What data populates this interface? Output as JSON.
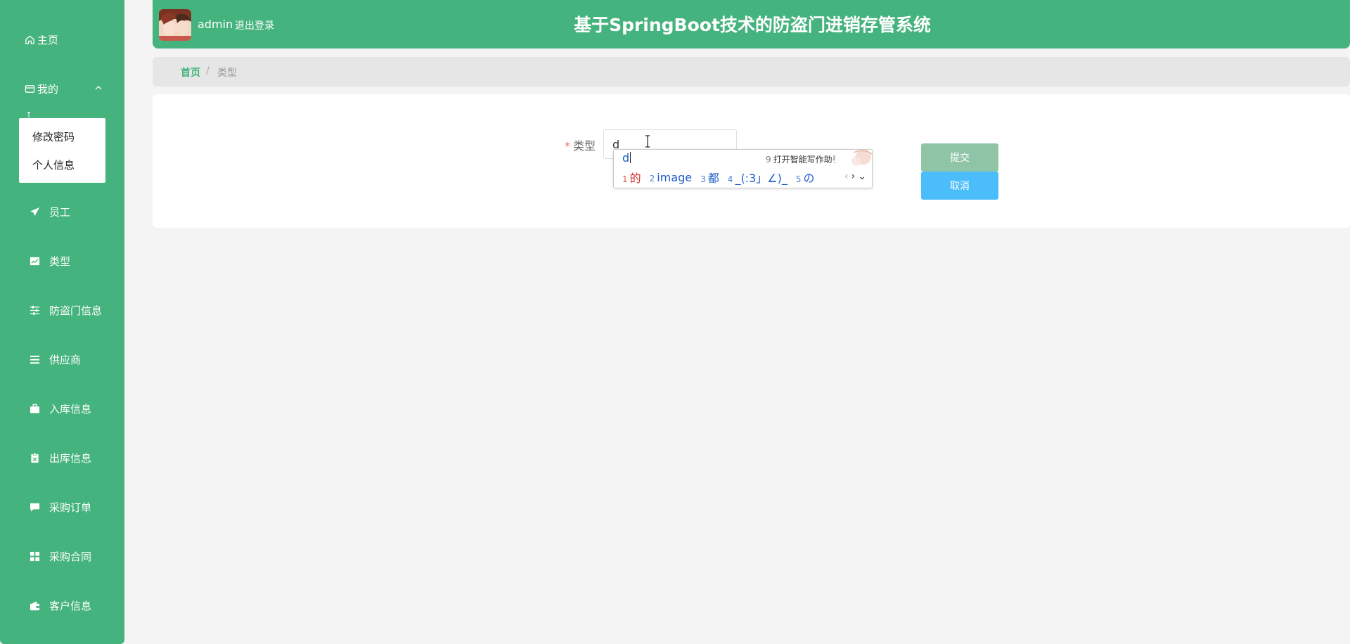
{
  "sidebar": {
    "home_label": "主页",
    "mine_label": "我的",
    "submenu": [
      {
        "label": "修改密码"
      },
      {
        "label": "个人信息"
      }
    ],
    "items": [
      {
        "label": "员工",
        "icon": "paper-plane-icon"
      },
      {
        "label": "类型",
        "icon": "chart-icon"
      },
      {
        "label": "防盗门信息",
        "icon": "sliders-icon"
      },
      {
        "label": "供应商",
        "icon": "list-icon"
      },
      {
        "label": "入库信息",
        "icon": "briefcase-icon"
      },
      {
        "label": "出库信息",
        "icon": "clipboard-icon"
      },
      {
        "label": "采购订单",
        "icon": "chat-icon"
      },
      {
        "label": "采购合同",
        "icon": "grid-icon"
      },
      {
        "label": "客户信息",
        "icon": "wallet-icon"
      }
    ]
  },
  "header": {
    "username": "admin",
    "logout_label": "退出登录",
    "title": "基于SpringBoot技术的防盗门进销存管系统"
  },
  "breadcrumb": {
    "home": "首页",
    "separator": "/",
    "current": "类型"
  },
  "form": {
    "required_mark": "*",
    "type_label": "类型",
    "type_value": "d",
    "submit_label": "提交",
    "cancel_label": "取消"
  },
  "ime": {
    "composition": "d",
    "assist_num": "9",
    "assist_label": "打开智能写作助手",
    "candidates": [
      {
        "n": "1",
        "w": "的"
      },
      {
        "n": "2",
        "w": "image"
      },
      {
        "n": "3",
        "w": "都"
      },
      {
        "n": "4",
        "w": "_(:3」∠)_"
      },
      {
        "n": "5",
        "w": "の"
      }
    ],
    "prev": "‹",
    "next": "›",
    "expand": "⌄"
  },
  "colors": {
    "brand_green": "#45b37d",
    "submit_button": "#8fc4a6",
    "cancel_button": "#4cbdfb",
    "required": "#f56c6c"
  }
}
